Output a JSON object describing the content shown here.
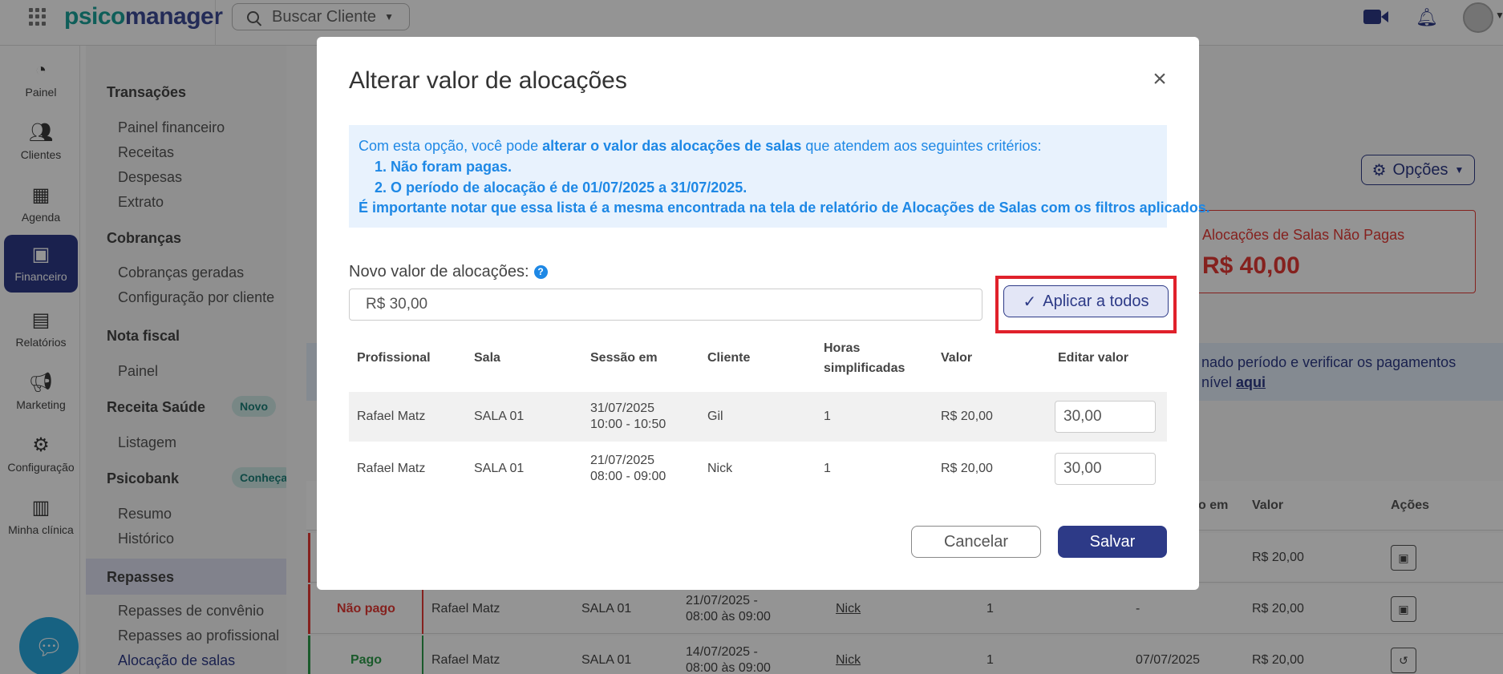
{
  "header": {
    "logo_prefix": "psico",
    "logo_suffix": "manager",
    "search_placeholder": "Buscar Cliente"
  },
  "rail": [
    {
      "label": "Painel",
      "icon": "dashboard-icon"
    },
    {
      "label": "Clientes",
      "icon": "users-icon"
    },
    {
      "label": "Agenda",
      "icon": "calendar-icon"
    },
    {
      "label": "Financeiro",
      "icon": "money-icon",
      "active": true
    },
    {
      "label": "Relatórios",
      "icon": "document-icon"
    },
    {
      "label": "Marketing",
      "icon": "megaphone-icon"
    },
    {
      "label": "Configuração",
      "icon": "gear-icon"
    },
    {
      "label": "Minha clínica",
      "icon": "building-icon"
    }
  ],
  "submenu": {
    "transacoes": "Transações",
    "painel_financeiro": "Painel financeiro",
    "receitas": "Receitas",
    "despesas": "Despesas",
    "extrato": "Extrato",
    "cobrancas": "Cobranças",
    "cobrancas_geradas": "Cobranças geradas",
    "config_cliente": "Configuração por cliente",
    "nota_fiscal": "Nota fiscal",
    "painel": "Painel",
    "receita_saude": "Receita Saúde",
    "novo_badge": "Novo",
    "listagem": "Listagem",
    "psicobank": "Psicobank",
    "conheca_badge": "Conheça",
    "resumo": "Resumo",
    "historico": "Histórico",
    "repasses": "Repasses",
    "repasses_convenio": "Repasses de convênio",
    "repasses_profissional": "Repasses ao profissional",
    "alocacao_salas": "Alocação de salas"
  },
  "background": {
    "options_button": "Opções",
    "unpaid_title": "Alocações de Salas Não Pagas",
    "unpaid_value": "R$ 40,00",
    "info_line1": "nado período e verificar os pagamentos",
    "info_line2_prefix": "nível",
    "info_link": "aqui",
    "table_headers": {
      "date_col": "o em",
      "valor": "Valor",
      "acoes": "Ações"
    },
    "rows": [
      {
        "status": "",
        "profissional": "",
        "sala": "",
        "sessao": "",
        "cliente": "",
        "horas": "",
        "data": "",
        "valor": "R$ 20,00",
        "status_type": "nao-pago"
      },
      {
        "status": "Não pago",
        "profissional": "Rafael Matz",
        "sala": "SALA 01",
        "sessao_l1": "21/07/2025 -",
        "sessao_l2": "08:00 às 09:00",
        "cliente": "Nick",
        "horas": "1",
        "data": "-",
        "valor": "R$ 20,00",
        "status_type": "nao-pago"
      },
      {
        "status": "Pago",
        "profissional": "Rafael Matz",
        "sala": "SALA 01",
        "sessao_l1": "14/07/2025 -",
        "sessao_l2": "08:00 às 09:00",
        "cliente": "Nick",
        "horas": "1",
        "data": "07/07/2025",
        "valor": "R$ 20,00",
        "status_type": "pago"
      }
    ]
  },
  "modal": {
    "title": "Alterar valor de alocações",
    "notice_intro_1": "Com esta opção, você pode ",
    "notice_intro_bold": "alterar o valor das alocações de salas",
    "notice_intro_2": " que atendem aos seguintes critérios:",
    "criterion_1": "1. Não foram pagas.",
    "criterion_2": "2. O período de alocação é de 01/07/2025 a 31/07/2025.",
    "notice_footer": "É importante notar que essa lista é a mesma encontrada na tela de relatório de Alocações de Salas com os filtros aplicados.",
    "field_label": "Novo valor de alocações:",
    "field_value": "R$ 30,00",
    "apply_button": "Aplicar a todos",
    "columns": {
      "profissional": "Profissional",
      "sala": "Sala",
      "sessao": "Sessão em",
      "cliente": "Cliente",
      "horas_l1": "Horas",
      "horas_l2": "simplificadas",
      "valor": "Valor",
      "editar": "Editar valor"
    },
    "rows": [
      {
        "profissional": "Rafael Matz",
        "sala": "SALA 01",
        "data": "31/07/2025",
        "hora": "10:00 - 10:50",
        "cliente": "Gil",
        "horas": "1",
        "valor": "R$ 20,00",
        "editar": "30,00"
      },
      {
        "profissional": "Rafael Matz",
        "sala": "SALA 01",
        "data": "21/07/2025",
        "hora": "08:00 - 09:00",
        "cliente": "Nick",
        "horas": "1",
        "valor": "R$ 20,00",
        "editar": "30,00"
      }
    ],
    "cancel_button": "Cancelar",
    "save_button": "Salvar"
  }
}
